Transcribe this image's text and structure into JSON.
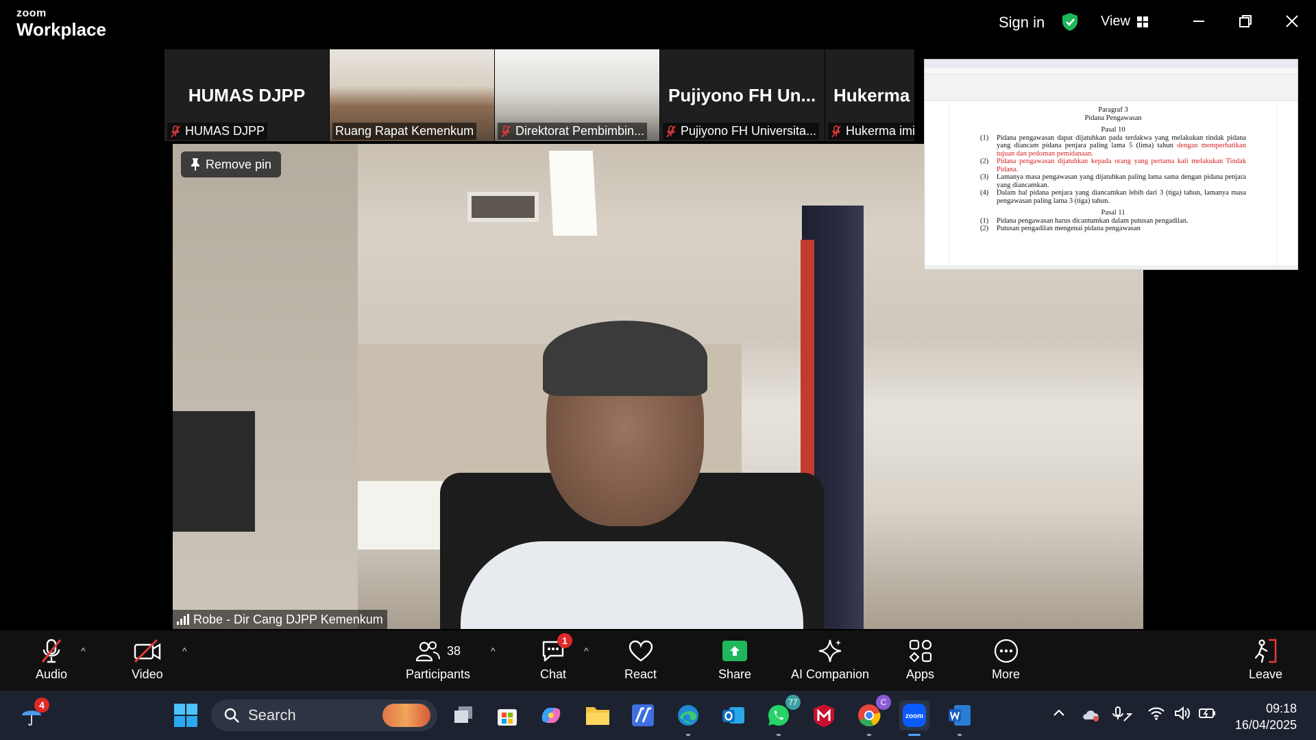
{
  "app": {
    "logo_small": "zoom",
    "logo_big": "Workplace",
    "sign_in": "Sign in",
    "view": "View",
    "accent_green": "#1fb65c"
  },
  "thumbnails": [
    {
      "big_name": "HUMAS DJPP",
      "label": "HUMAS DJPP",
      "muted": true
    },
    {
      "label": "Ruang Rapat Kemenkum",
      "muted": false,
      "video": true
    },
    {
      "label": "Direktorat Pembimbin...",
      "muted": true,
      "video": true
    },
    {
      "big_name": "Pujiyono FH Un...",
      "label": "Pujiyono FH Universita...",
      "muted": true
    },
    {
      "big_name": "Hukerma i",
      "label": "Hukerma imi",
      "muted": true
    }
  ],
  "shared_doc": {
    "heading1": "Paragraf 3",
    "heading2": "Pidana Pengawasan",
    "pasal10": "Pasal 10",
    "items10": [
      {
        "n": "(1)",
        "text": "Pidana pengawasan dapat dijatuhkan pada terdakwa yang melakukan tindak pidana yang diancam pidana penjara paling lama 5 (lima) tahun",
        "red": "dengan memperhatikan tujuan dan pedoman pemidanaan."
      },
      {
        "n": "(2)",
        "text": "",
        "red": "Pidana pengawasan dijatuhkan kepada orang yang pertama kali melakukan Tindak Pidana."
      },
      {
        "n": "(3)",
        "text": "Lamanya masa pengawasan yang dijatuhkan paling lama sama dengan pidana penjara yang diancamkan.",
        "red": ""
      },
      {
        "n": "(4)",
        "text": "Dalam hal pidana penjara yang diancamkan lebih dari 3 (tiga) tahun, lamanya masa pengawasan paling lama 3 (tiga) tahun.",
        "red": ""
      }
    ],
    "pasal11": "Pasal 11",
    "items11": [
      {
        "n": "(1)",
        "text": "Pidana pengawasan harus dicantumkan dalam putusan pengadilan."
      },
      {
        "n": "(2)",
        "text": "Putusan pengadilan mengenai pidana pengawasan"
      }
    ]
  },
  "main_video": {
    "remove_pin": "Remove pin",
    "name": "Robe - Dir Cang DJPP Kemenkum"
  },
  "toolbar": {
    "audio": "Audio",
    "video": "Video",
    "participants": "Participants",
    "participants_count": "38",
    "chat": "Chat",
    "chat_badge": "1",
    "react": "React",
    "share": "Share",
    "ai_companion": "AI Companion",
    "apps": "Apps",
    "more": "More",
    "leave": "Leave"
  },
  "taskbar": {
    "weather_badge": "4",
    "search_placeholder": "Search",
    "whatsapp_badge": "77",
    "chrome_badge": "C",
    "time": "09:18",
    "date": "16/04/2025"
  }
}
